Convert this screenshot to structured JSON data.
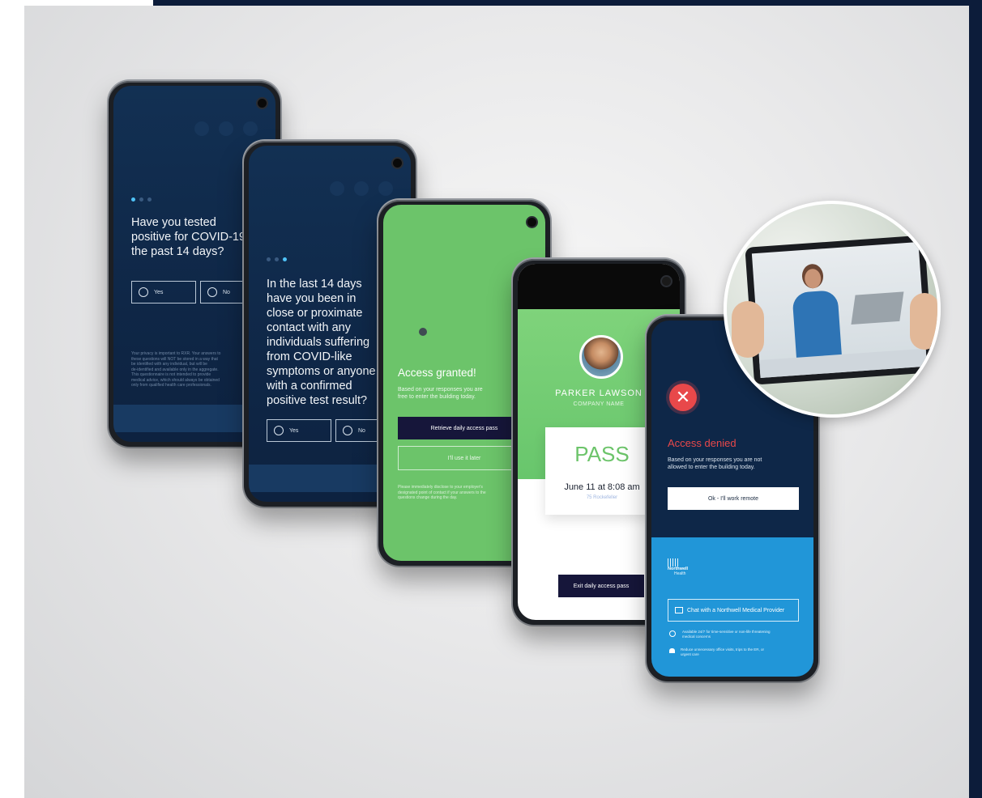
{
  "colors": {
    "navy": "#0f2747",
    "green": "#6cc46a",
    "blue": "#2196d8",
    "dark_button": "#16163a",
    "denied_red": "#e8484a",
    "accent_cyan": "#4fc3f7"
  },
  "phone1": {
    "question": "Have you tested positive for COVID-19 in the past 14 days?",
    "question_lines": [
      "Have you tested",
      "positive for COVID-19",
      "the past 14 days?"
    ],
    "yes_label": "Yes",
    "no_label": "No",
    "privacy_lines": [
      "Your privacy is important to RXR.  Your answers to",
      "these questions will NOT be stored in a way that",
      "be identified with any individual, but will be",
      "de-identified and available only in the aggregate.",
      "This questionnaire is not intended to provide",
      "medical advice, which should always be obtained",
      "only from qualified health care professionals."
    ]
  },
  "phone2": {
    "question_lines": [
      "In the last 14 days",
      "have you been in",
      "close or proximate",
      "contact with any",
      "individuals suffering",
      "from COVID-like",
      "symptoms or anyone",
      "with a confirmed",
      "positive test result?"
    ],
    "yes_label": "Yes",
    "no_label": "No"
  },
  "phone3": {
    "title": "Access granted!",
    "subtitle_lines": [
      "Based on your responses you are",
      "free to enter the building today."
    ],
    "primary_button": "Retrieve daily access pass",
    "secondary_button": "I'll use it later",
    "note_lines": [
      "Please immediately disclose to your employer's",
      "designated point of contact if your answers to the",
      "questions change during the day."
    ]
  },
  "phone4": {
    "name": "PARKER LAWSON",
    "company": "COMPANY NAME",
    "pass_label": "PASS",
    "date_time": "June 11 at 8:08 am",
    "address": "75 Rockefeller",
    "exit_button": "Exit daily access pass"
  },
  "phone5": {
    "title": "Access denied",
    "subtitle_lines": [
      "Based on your responses you are not",
      "allowed to enter the building today."
    ],
    "ok_button": "Ok - I'll work remote",
    "brand_name": "Northwell",
    "brand_sub": "Health",
    "chat_button": "Chat with a Northwell Medical Provider",
    "info1_lines": [
      "Available 24/7 for time-sensitive or non-life threatening",
      "medical concerns"
    ],
    "info2_lines": [
      "Reduce unnecessary office visits, trips to the ER, or",
      "urgent care"
    ]
  }
}
